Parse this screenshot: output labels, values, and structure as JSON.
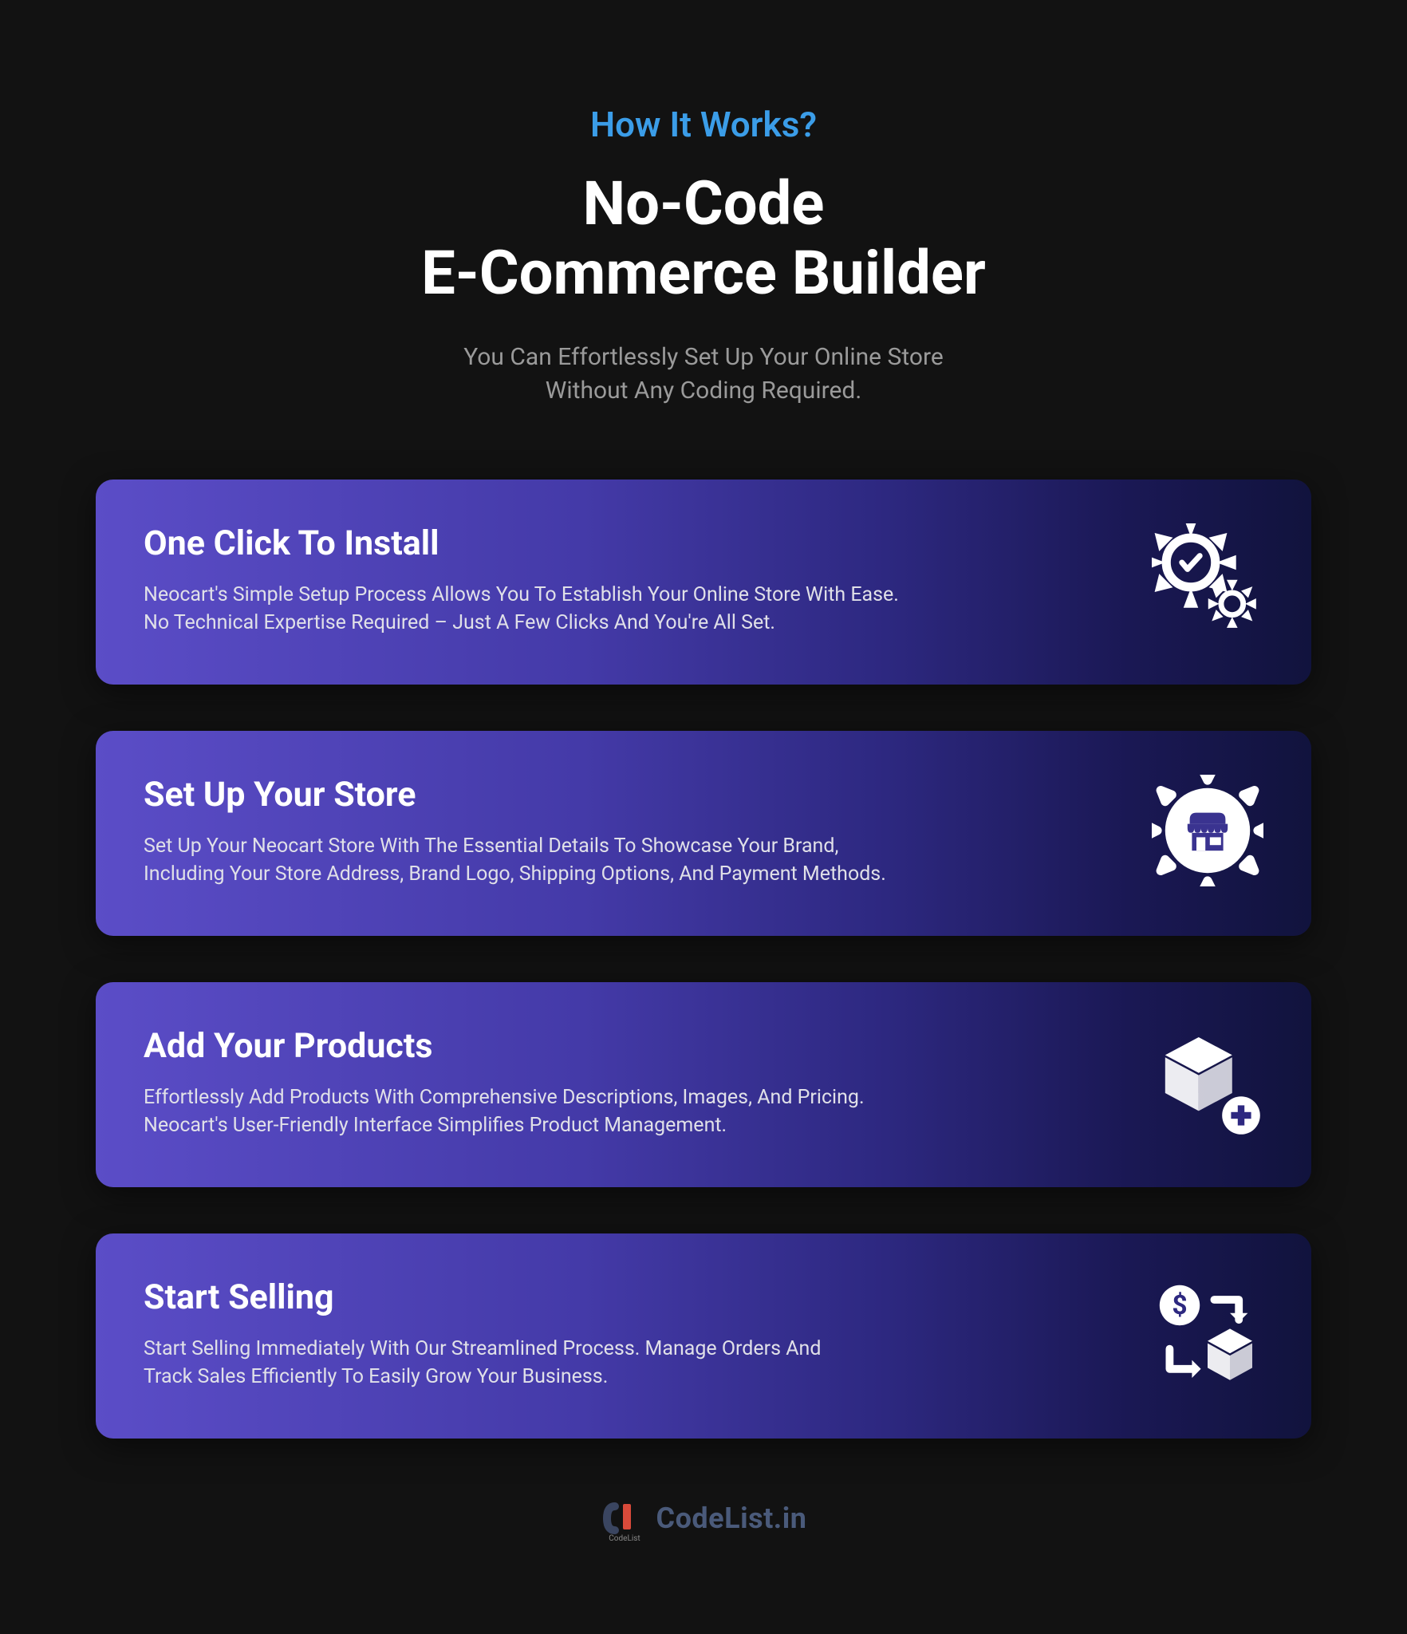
{
  "header": {
    "eyebrow": "How It Works?",
    "title_line1": "No-Code",
    "title_line2": "E-Commerce Builder",
    "subtitle_line1": "You Can Effortlessly Set Up Your Online Store",
    "subtitle_line2": "Without Any Coding Required."
  },
  "cards": [
    {
      "title": "One Click To Install",
      "desc_line1": "Neocart's Simple Setup Process Allows You To Establish Your Online Store With Ease.",
      "desc_line2": "No Technical Expertise Required – Just A Few Clicks And You're All Set.",
      "icon": "install-gears"
    },
    {
      "title": "Set Up Your Store",
      "desc_line1": "Set Up Your Neocart Store With The Essential Details To Showcase Your Brand,",
      "desc_line2": "Including Your Store Address, Brand Logo, Shipping Options, And Payment Methods.",
      "icon": "store-gear"
    },
    {
      "title": "Add Your Products",
      "desc_line1": "Effortlessly Add Products With Comprehensive Descriptions, Images, And Pricing.",
      "desc_line2": "Neocart's User-Friendly Interface Simplifies Product Management.",
      "icon": "box-plus"
    },
    {
      "title": "Start Selling",
      "desc_line1": "Start Selling Immediately With Our Streamlined Process. Manage Orders And",
      "desc_line2": "Track Sales Efficiently To Easily Grow Your Business.",
      "icon": "sales-cycle"
    }
  ],
  "footer": {
    "brand": "CodeList.in",
    "sublabel": "CodeList"
  }
}
